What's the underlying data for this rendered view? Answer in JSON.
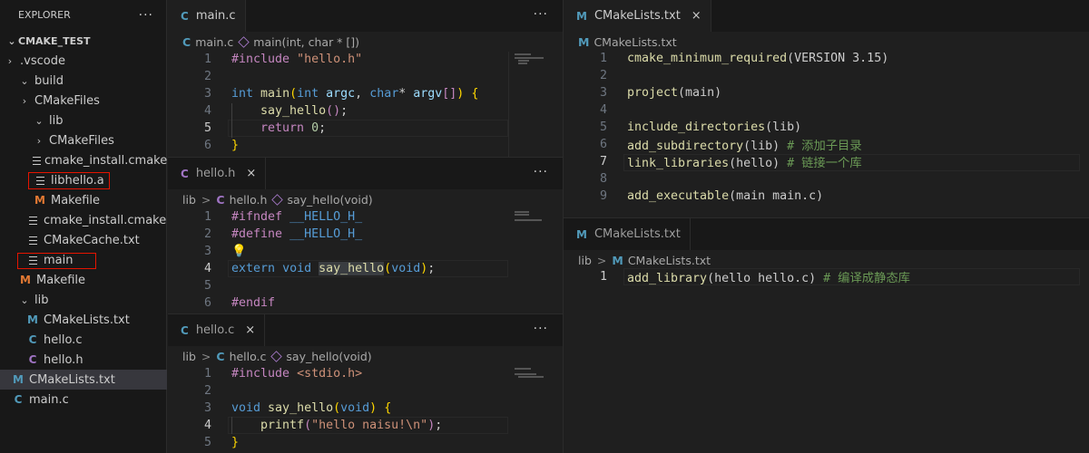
{
  "explorer": {
    "title": "EXPLORER",
    "more": "···",
    "root": "CMAKE_TEST",
    "items": [
      {
        "label": ".vscode",
        "icon": "chevron-right"
      },
      {
        "label": "build",
        "icon": "chevron-down"
      },
      {
        "label": "CMakeFiles",
        "icon": "chevron-right"
      },
      {
        "label": "lib",
        "icon": "chevron-down"
      },
      {
        "label": "CMakeFiles",
        "icon": "chevron-right"
      },
      {
        "label": "cmake_install.cmake",
        "icon": "lines-icon"
      },
      {
        "label": "libhello.a",
        "icon": "lines-icon"
      },
      {
        "label": "Makefile",
        "icon": "makefile-icon"
      },
      {
        "label": "cmake_install.cmake",
        "icon": "lines-icon"
      },
      {
        "label": "CMakeCache.txt",
        "icon": "lines-icon"
      },
      {
        "label": "main",
        "icon": "lines-icon"
      },
      {
        "label": "Makefile",
        "icon": "makefile-icon"
      },
      {
        "label": "lib",
        "icon": "chevron-down"
      },
      {
        "label": "CMakeLists.txt",
        "icon": "cmake-icon"
      },
      {
        "label": "hello.c",
        "icon": "c-file-icon"
      },
      {
        "label": "hello.h",
        "icon": "h-file-icon"
      },
      {
        "label": "CMakeLists.txt",
        "icon": "cmake-icon"
      },
      {
        "label": "main.c",
        "icon": "c-file-icon"
      }
    ],
    "icon_glyphs": {
      "cmake": "M",
      "make": "M",
      "c": "C"
    }
  },
  "pane_main_c": {
    "tab": "main.c",
    "crumb_file": "main.c",
    "crumb_symbol": "main(int, char * [])",
    "lines": [
      {
        "n": "1",
        "text": "#include \"hello.h\""
      },
      {
        "n": "2",
        "text": ""
      },
      {
        "n": "3",
        "text": "int main(int argc, char* argv[]) {"
      },
      {
        "n": "4",
        "text": "    say_hello();"
      },
      {
        "n": "5",
        "text": "    return 0;"
      },
      {
        "n": "6",
        "text": "}"
      }
    ]
  },
  "pane_hello_h": {
    "tab": "hello.h",
    "crumb_dir": "lib",
    "crumb_file": "hello.h",
    "crumb_symbol": "say_hello(void)",
    "lines": [
      {
        "n": "1",
        "text": "#ifndef __HELLO_H_"
      },
      {
        "n": "2",
        "text": "#define __HELLO_H_"
      },
      {
        "n": "3",
        "text": ""
      },
      {
        "n": "4",
        "text": "extern void say_hello(void);"
      },
      {
        "n": "5",
        "text": ""
      },
      {
        "n": "6",
        "text": "#endif"
      }
    ]
  },
  "pane_hello_c": {
    "tab": "hello.c",
    "crumb_dir": "lib",
    "crumb_file": "hello.c",
    "crumb_symbol": "say_hello(void)",
    "lines": [
      {
        "n": "1",
        "text": "#include <stdio.h>"
      },
      {
        "n": "2",
        "text": ""
      },
      {
        "n": "3",
        "text": "void say_hello(void) {"
      },
      {
        "n": "4",
        "text": "    printf(\"hello naisu!\\n\");"
      },
      {
        "n": "5",
        "text": "}"
      }
    ]
  },
  "pane_cmakelists_root": {
    "tab": "CMakeLists.txt",
    "crumb_file": "CMakeLists.txt",
    "lines": [
      {
        "n": "1",
        "text": "cmake_minimum_required(VERSION 3.15)"
      },
      {
        "n": "2",
        "text": ""
      },
      {
        "n": "3",
        "text": "project(main)"
      },
      {
        "n": "4",
        "text": ""
      },
      {
        "n": "5",
        "text": "include_directories(lib)"
      },
      {
        "n": "6",
        "text": "add_subdirectory(lib) # 添加子目录"
      },
      {
        "n": "7",
        "text": "link_libraries(hello) # 链接一个库"
      },
      {
        "n": "8",
        "text": ""
      },
      {
        "n": "9",
        "text": "add_executable(main main.c)"
      }
    ]
  },
  "pane_cmakelists_lib": {
    "tab": "CMakeLists.txt",
    "crumb_dir": "lib",
    "crumb_file": "CMakeLists.txt",
    "lines": [
      {
        "n": "1",
        "text": "add_library(hello hello.c) # 编译成静态库"
      }
    ]
  },
  "ui": {
    "more": "···",
    "close": "×",
    "sep": ">"
  },
  "colors": {
    "background": "#1f1f1f",
    "sidebar": "#181818",
    "highlight_box": "#e51400",
    "keyword": "#569cd6",
    "function": "#dcdcaa",
    "string": "#ce9178",
    "comment": "#6a9955"
  }
}
